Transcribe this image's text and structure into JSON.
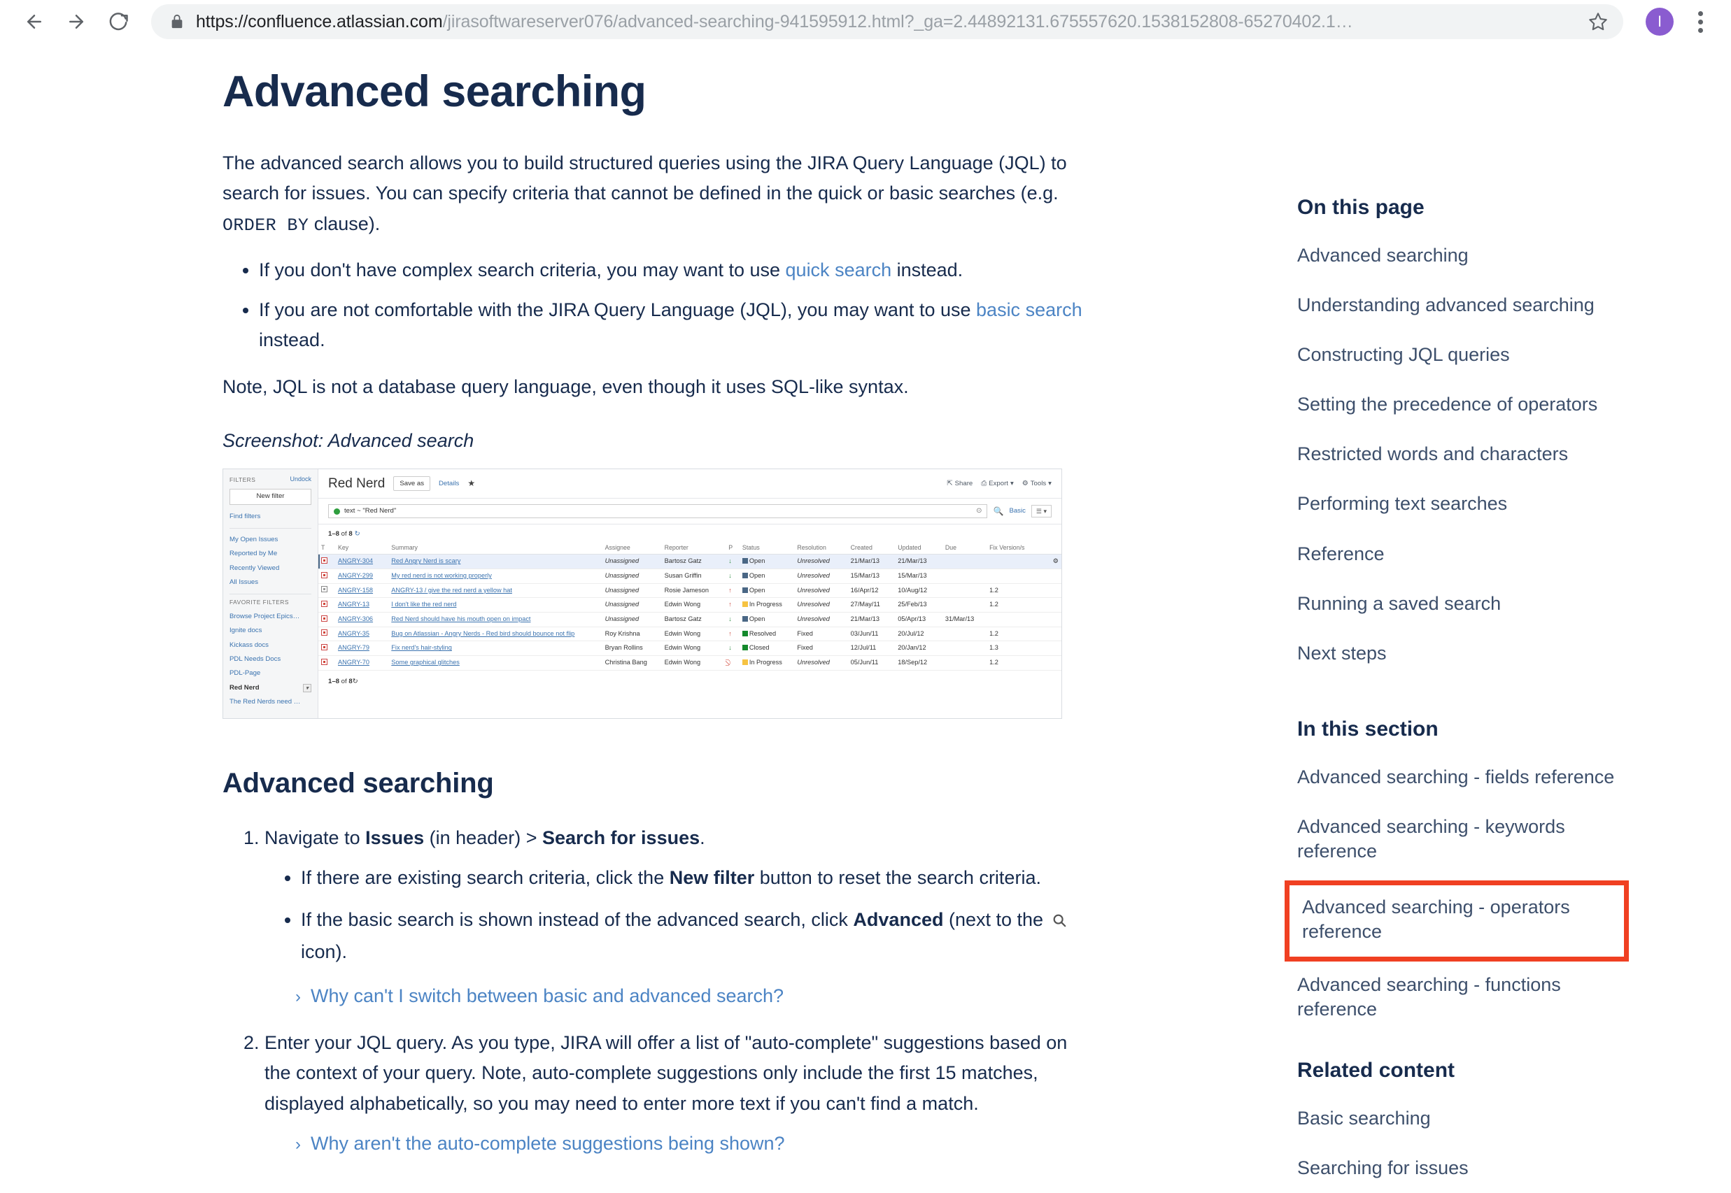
{
  "browser": {
    "back_icon": "back-arrow-icon",
    "forward_icon": "forward-arrow-icon",
    "reload_icon": "reload-icon",
    "lock_icon": "lock-icon",
    "url_host": "https://confluence.atlassian.com",
    "url_path": "/jirasoftwareserver076/advanced-searching-941595912.html?_ga=2.44892131.675557620.1538152808-65270402.1…",
    "star_icon": "bookmark-star-icon",
    "avatar_initial": "I",
    "menu_icon": "kebab-menu-icon"
  },
  "page": {
    "title": "Advanced searching",
    "intro": "The advanced search allows you to build structured queries using the JIRA Query Language (JQL) to search for issues. You can specify criteria that cannot be defined in the quick or basic searches (e.g. ",
    "intro_code": "ORDER BY",
    "intro_tail": " clause).",
    "bullets": [
      {
        "pre": "If you don't have complex search criteria, you may want to use ",
        "link": "quick search",
        "post": " instead."
      },
      {
        "pre": "If you are not comfortable with the JIRA Query Language (JQL), you may want to use ",
        "link": "basic search",
        "post": " instead."
      }
    ],
    "note": "Note, JQL is not a database query language, even though it uses SQL-like syntax.",
    "caption": "Screenshot: Advanced search"
  },
  "screenshot": {
    "sidebar": {
      "filters_label": "FILTERS",
      "undock_label": "Undock",
      "new_filter_button": "New filter",
      "find_filters": "Find filters",
      "system_filters": [
        "My Open Issues",
        "Reported by Me",
        "Recently Viewed",
        "All Issues"
      ],
      "favorite_label": "FAVORITE FILTERS",
      "favorite_filters": [
        "Browse Project Epics…",
        "Ignite docs",
        "Kickass docs",
        "PDL Needs Docs",
        "PDL-Page"
      ],
      "current_filter": "Red Nerd",
      "last_filter": "The Red Nerds need …"
    },
    "header": {
      "filter_name": "Red Nerd",
      "save_as": "Save as",
      "details": "Details",
      "star_icon": "star-icon",
      "share": "Share",
      "export": "Export",
      "tools": "Tools"
    },
    "query": {
      "text": "text ~ \"Red Nerd\"",
      "help_icon": "help-circle-icon",
      "search_icon": "search-icon",
      "basic_link": "Basic",
      "view_menu_icon": "list-view-icon"
    },
    "count_prefix": "1–8",
    "count_suffix": " of ",
    "count_total": "8",
    "columns": [
      "T",
      "Key",
      "Summary",
      "Assignee",
      "Reporter",
      "P",
      "Status",
      "Resolution",
      "Created",
      "Updated",
      "Due",
      "Fix Version/s"
    ],
    "rows": [
      {
        "type": "bug",
        "key": "ANGRY-304",
        "summary": "Red Angry Nerd is scary",
        "assignee": "Unassigned",
        "reporter": "Bartosz Gatz",
        "priority": "down",
        "status": "Open",
        "resolution": "Unresolved",
        "created": "21/Mar/13",
        "updated": "21/Mar/13",
        "due": "",
        "fix": ""
      },
      {
        "type": "bug",
        "key": "ANGRY-299",
        "summary": "My red nerd is not working properly",
        "assignee": "Unassigned",
        "reporter": "Susan Griffin",
        "priority": "down",
        "status": "Open",
        "resolution": "Unresolved",
        "created": "15/Mar/13",
        "updated": "15/Mar/13",
        "due": "",
        "fix": ""
      },
      {
        "type": "sub",
        "key": "ANGRY-158",
        "summary": "ANGRY-13 /  give the red nerd a yellow hat",
        "assignee": "Unassigned",
        "reporter": "Rosie Jameson",
        "priority": "up",
        "status": "Open",
        "resolution": "Unresolved",
        "created": "16/Apr/12",
        "updated": "10/Aug/12",
        "due": "",
        "fix": "1.2"
      },
      {
        "type": "bug",
        "key": "ANGRY-13",
        "summary": "I don't like the red nerd",
        "assignee": "Unassigned",
        "reporter": "Edwin Wong",
        "priority": "up",
        "status": "In Progress",
        "resolution": "Unresolved",
        "created": "27/May/11",
        "updated": "25/Feb/13",
        "due": "",
        "fix": "1.2"
      },
      {
        "type": "bug",
        "key": "ANGRY-306",
        "summary": "Red Nerd should have his mouth open on impact",
        "assignee": "Unassigned",
        "reporter": "Bartosz Gatz",
        "priority": "down",
        "status": "Open",
        "resolution": "Unresolved",
        "created": "21/Mar/13",
        "updated": "05/Apr/13",
        "due": "31/Mar/13",
        "fix": ""
      },
      {
        "type": "bug",
        "key": "ANGRY-35",
        "summary": "Bug on Atlassian - Angry Nerds - Red bird should bounce not flip",
        "assignee": "Roy Krishna",
        "reporter": "Edwin Wong",
        "priority": "up",
        "status": "Resolved",
        "resolution": "Fixed",
        "created": "03/Jun/11",
        "updated": "20/Jul/12",
        "due": "",
        "fix": "1.2"
      },
      {
        "type": "bug",
        "key": "ANGRY-79",
        "summary": "Fix nerd's hair-styling",
        "assignee": "Bryan Rollins",
        "reporter": "Edwin Wong",
        "priority": "down",
        "status": "Closed",
        "resolution": "Fixed",
        "created": "12/Jul/11",
        "updated": "20/Jan/12",
        "due": "",
        "fix": "1.3"
      },
      {
        "type": "bug",
        "key": "ANGRY-70",
        "summary": "Some graphical glitches",
        "assignee": "Christina Bang",
        "reporter": "Edwin Wong",
        "priority": "blocked",
        "status": "In Progress",
        "resolution": "Unresolved",
        "created": "05/Jun/11",
        "updated": "18/Sep/12",
        "due": "",
        "fix": "1.2"
      }
    ]
  },
  "section": {
    "heading": "Advanced searching",
    "step1_pre": "Navigate to ",
    "step1_b1": "Issues",
    "step1_mid": " (in header) > ",
    "step1_b2": "Search for issues",
    "step1_post": ".",
    "step1_sub1_pre": "If there are existing search criteria, click the ",
    "step1_sub1_b": "New filter",
    "step1_sub1_post": " button to reset the search criteria.",
    "step1_sub2_pre": "If the basic search is shown instead of the advanced search, click ",
    "step1_sub2_b": "Advanced",
    "step1_sub2_mid": " (next to the ",
    "step1_sub2_post": " icon).",
    "expander1": "Why can't I switch between basic and advanced search?",
    "step2": "Enter your JQL query. As you type, JIRA will offer a list of \"auto-complete\" suggestions based on the context of your query. Note, auto-complete suggestions only include the first 15 matches, displayed alphabetically, so you may need to enter more text if you can't find a match.",
    "expander2": "Why aren't the auto-complete suggestions being shown?"
  },
  "sidebar": {
    "on_this_page_title": "On this page",
    "on_this_page": [
      "Advanced searching",
      "Understanding advanced searching",
      "Constructing JQL queries",
      "Setting the precedence of operators",
      "Restricted words and characters",
      "Performing text searches",
      "Reference",
      "Running a saved search",
      "Next steps"
    ],
    "in_this_section_title": "In this section",
    "in_this_section": [
      "Advanced searching - fields reference",
      "Advanced searching - keywords reference",
      "Advanced searching - operators reference",
      "Advanced searching - functions reference"
    ],
    "highlighted_index": 2,
    "highlight_color": "#f04022",
    "related_content_title": "Related content",
    "related_content": [
      "Basic searching",
      "Searching for issues"
    ]
  }
}
